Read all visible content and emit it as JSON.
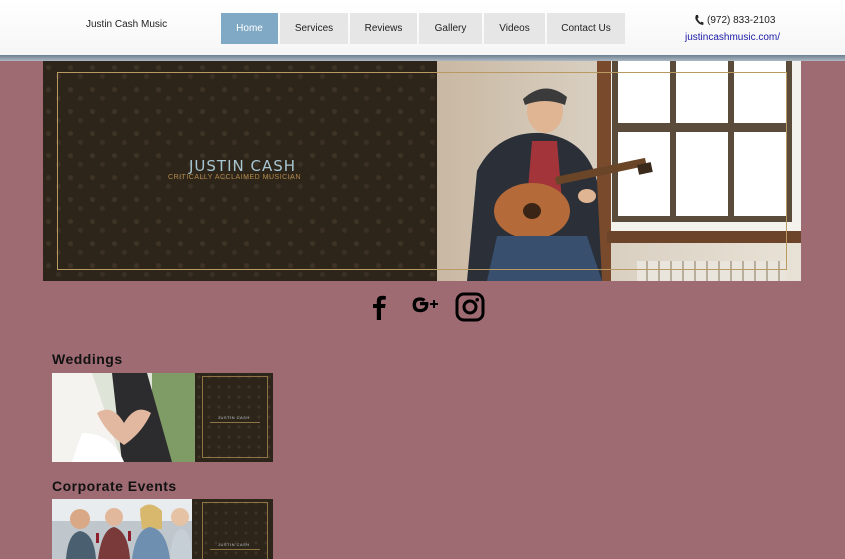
{
  "header": {
    "site_title": "Justin Cash Music",
    "nav": [
      {
        "label": "Home",
        "active": true
      },
      {
        "label": "Services",
        "active": false
      },
      {
        "label": "Reviews",
        "active": false
      },
      {
        "label": "Gallery",
        "active": false
      },
      {
        "label": "Videos",
        "active": false
      },
      {
        "label": "Contact Us",
        "active": false
      }
    ],
    "phone": "(972) 833-2103",
    "url": "justincashmusic.com/"
  },
  "hero": {
    "name": "JUSTIN CASH",
    "tagline": "CRITICALLY ACCLAIMED MUSICIAN"
  },
  "social": [
    {
      "icon": "facebook-icon"
    },
    {
      "icon": "google-plus-icon"
    },
    {
      "icon": "instagram-icon"
    }
  ],
  "sections": [
    {
      "title": "Weddings",
      "thumb_text": "JUSTIN CASH"
    },
    {
      "title": "Corporate Events",
      "thumb_text": "JUSTIN CASH"
    }
  ],
  "colors": {
    "page_background": "#9e6b73",
    "nav_active": "#7fa9c5",
    "hero_dark": "#2d251a",
    "frame_gold": "#b99a62"
  }
}
